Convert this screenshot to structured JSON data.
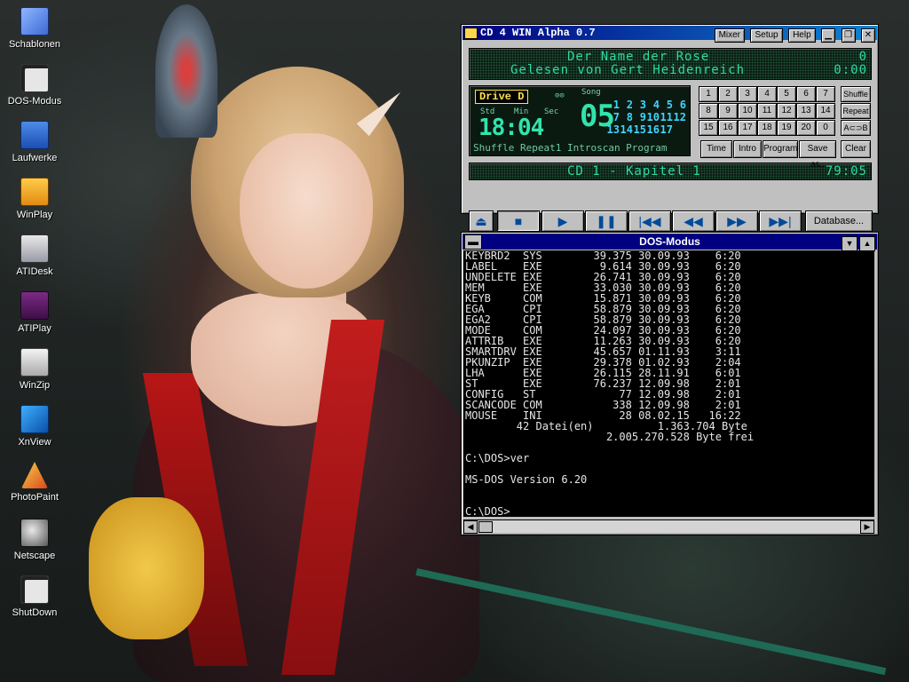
{
  "desktop": {
    "icons": [
      {
        "label": "Schablonen",
        "icon": "mac-face-icon"
      },
      {
        "label": "DOS-Modus",
        "icon": "dos-window-icon"
      },
      {
        "label": "Laufwerke",
        "icon": "drive-icon"
      },
      {
        "label": "WinPlay",
        "icon": "winplay-icon"
      },
      {
        "label": "ATIDesk",
        "icon": "atidesk-icon"
      },
      {
        "label": "ATIPlay",
        "icon": "atiplay-icon"
      },
      {
        "label": "WinZip",
        "icon": "winzip-icon"
      },
      {
        "label": "XnView",
        "icon": "xnview-icon"
      },
      {
        "label": "PhotoPaint",
        "icon": "photopaint-icon"
      },
      {
        "label": "Netscape",
        "icon": "netscape-icon"
      },
      {
        "label": "ShutDown",
        "icon": "shutdown-icon"
      }
    ]
  },
  "cdplayer": {
    "title": "CD 4 WIN Alpha 0.7",
    "menu": {
      "mixer": "Mixer",
      "setup": "Setup",
      "help": "Help"
    },
    "display": {
      "line1": "Der Name der Rose",
      "line2": "Gelesen von Gert Heidenreich",
      "track_num": "0",
      "track_time": "0:00",
      "drive": "Drive D",
      "labels": {
        "std": "Std",
        "min": "Min",
        "sec": "Sec",
        "song": "Song"
      },
      "time": "18:04",
      "song_number": "05",
      "songs": [
        "1",
        "2",
        "3",
        "4",
        "5",
        "6",
        "7",
        "8",
        "9",
        "10",
        "11",
        "12",
        "13",
        "14",
        "15",
        "16",
        "17"
      ],
      "modes": "Shuffle Repeat1 Introscan Program",
      "status_line": "CD 1 - Kapitel 1",
      "total_time": "79:05"
    },
    "numpad": [
      "1",
      "2",
      "3",
      "4",
      "5",
      "6",
      "7",
      "8",
      "9",
      "10",
      "11",
      "12",
      "13",
      "14",
      "15",
      "16",
      "17",
      "18",
      "19",
      "20",
      "0"
    ],
    "side_buttons": {
      "shuffle": "Shuffle",
      "repeat": "Repeat",
      "ab": "A⊂⊃B",
      "clear": "Clear"
    },
    "function_buttons": {
      "time": "Time",
      "intro": "Intro",
      "program": "Program",
      "saveas": "Save as.."
    },
    "database_label": "Database..."
  },
  "dos": {
    "title": "DOS-Modus",
    "lines": [
      "KEYBRD2  SYS        39.375 30.09.93    6:20",
      "LABEL    EXE         9.614 30.09.93    6:20",
      "UNDELETE EXE        26.741 30.09.93    6:20",
      "MEM      EXE        33.030 30.09.93    6:20",
      "KEYB     COM        15.871 30.09.93    6:20",
      "EGA      CPI        58.879 30.09.93    6:20",
      "EGA2     CPI        58.879 30.09.93    6:20",
      "MODE     COM        24.097 30.09.93    6:20",
      "ATTRIB   EXE        11.263 30.09.93    6:20",
      "SMARTDRV EXE        45.657 01.11.93    3:11",
      "PKUNZIP  EXE        29.378 01.02.93    2:04",
      "LHA      EXE        26.115 28.11.91    6:01",
      "ST       EXE        76.237 12.09.98    2:01",
      "CONFIG   ST             77 12.09.98    2:01",
      "SCANCODE COM           338 12.09.98    2:01",
      "MOUSE    INI            28 08.02.15   16:22",
      "        42 Datei(en)          1.363.704 Byte",
      "                      2.005.270.528 Byte frei",
      "",
      "C:\\DOS>ver",
      "",
      "MS-DOS Version 6.20",
      "",
      "",
      "C:\\DOS>"
    ]
  }
}
